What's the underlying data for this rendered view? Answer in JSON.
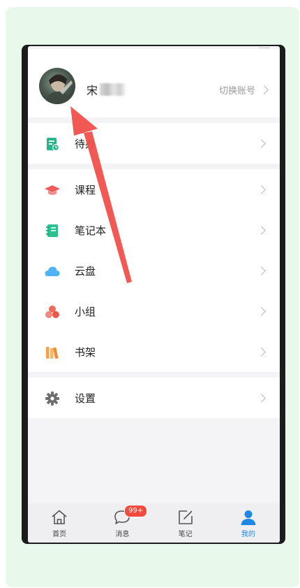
{
  "profile": {
    "name": "宋",
    "switch_account": "切换账号"
  },
  "menu_groups": [
    [
      {
        "label": "待办",
        "icon": "todo-icon"
      }
    ],
    [
      {
        "label": "课程",
        "icon": "course-cap-icon"
      },
      {
        "label": "笔记本",
        "icon": "notebook-icon"
      },
      {
        "label": "云盘",
        "icon": "cloud-icon"
      },
      {
        "label": "小组",
        "icon": "group-icon"
      },
      {
        "label": "书架",
        "icon": "bookshelf-icon"
      }
    ],
    [
      {
        "label": "设置",
        "icon": "gear-icon"
      }
    ]
  ],
  "tabbar": {
    "tabs": [
      {
        "label": "首页",
        "icon": "home-icon"
      },
      {
        "label": "消息",
        "icon": "message-icon",
        "badge": "99+"
      },
      {
        "label": "笔记",
        "icon": "note-edit-icon"
      },
      {
        "label": "我的",
        "icon": "person-icon",
        "active": true
      }
    ]
  },
  "colors": {
    "accent": "#1e88e5",
    "todo": "#2ab48c",
    "course": "#f05a5a",
    "notebook": "#2cbf8f",
    "cloud": "#4fb3f6",
    "group": "#f06b5d",
    "bookshelf": "#f5a04a",
    "badge": "#f24b3e",
    "annotation_arrow": "#f2504b"
  }
}
